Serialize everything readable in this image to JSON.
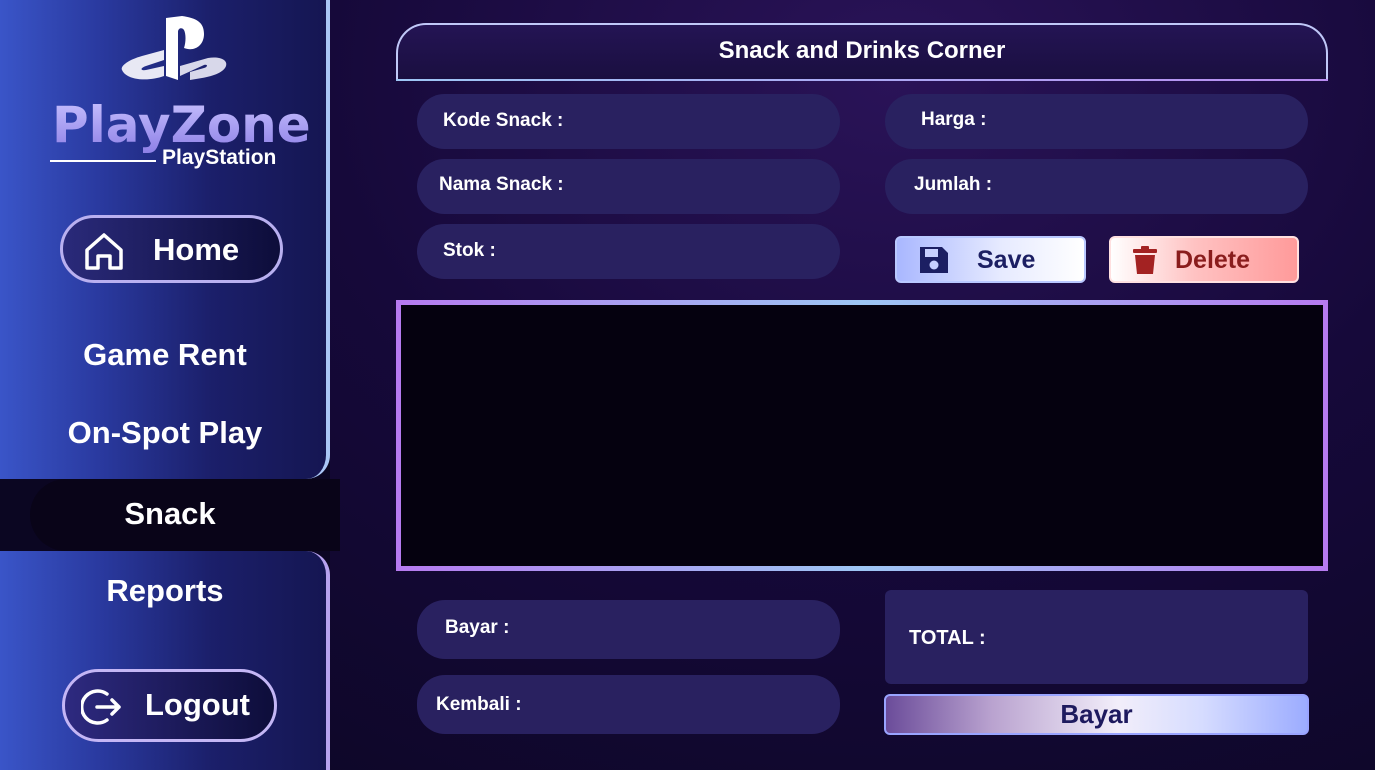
{
  "sidebar": {
    "brand": "PlayZone",
    "brand_sub": "PlayStation",
    "home_label": "Home",
    "nav": {
      "game_rent": "Game Rent",
      "on_spot_play": "On-Spot Play",
      "snack": "Snack",
      "reports": "Reports"
    },
    "logout_label": "Logout"
  },
  "main": {
    "title": "Snack and Drinks Corner",
    "fields": {
      "kode_snack": "Kode Snack :",
      "nama_snack": "Nama Snack :",
      "stok": "Stok :",
      "harga": "Harga :",
      "jumlah": "Jumlah :",
      "bayar": "Bayar :",
      "kembali": "Kembali :"
    },
    "buttons": {
      "save": "Save",
      "delete": "Delete",
      "bayar": "Bayar"
    },
    "total_label": "TOTAL :"
  },
  "colors": {
    "background": "#16093a",
    "field_bg": "#292160",
    "accent_lavender": "#b9b0f0",
    "save_text": "#1c1f63",
    "delete_text": "#8a1d1d"
  },
  "icons": [
    "playstation-logo",
    "home-icon",
    "logout-icon",
    "save-icon",
    "trash-icon"
  ]
}
